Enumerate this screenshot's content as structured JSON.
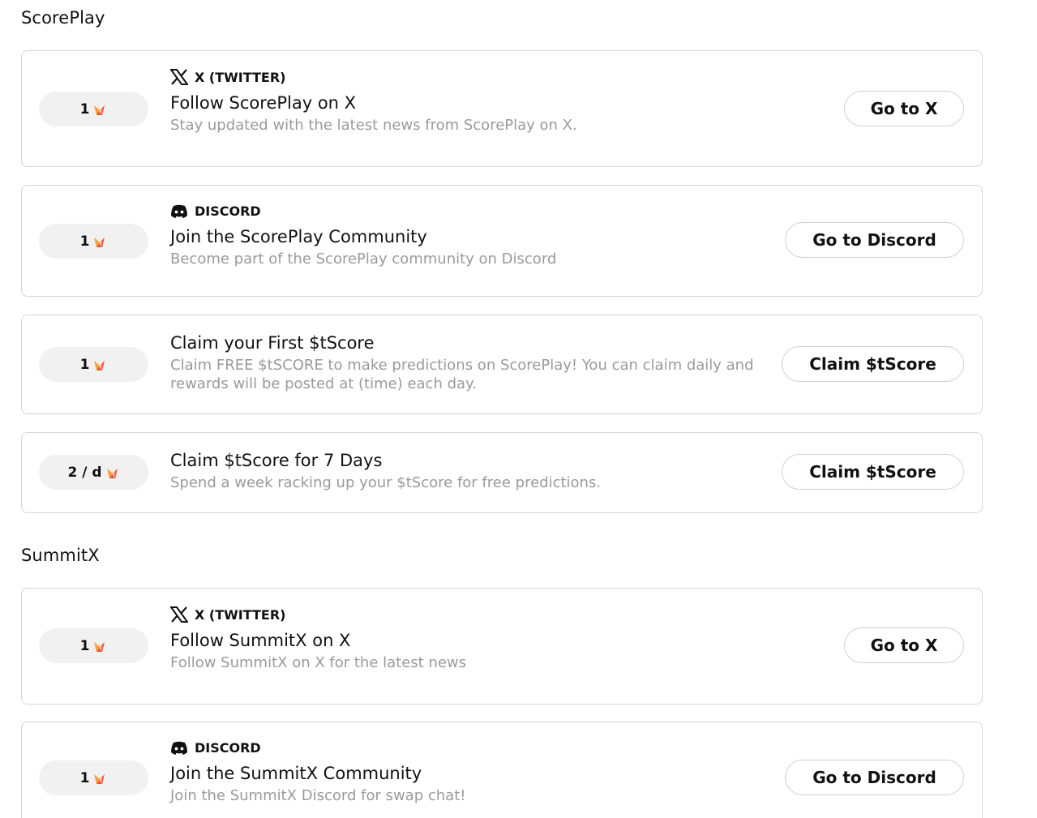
{
  "sections": [
    {
      "title": "ScorePlay",
      "tasks": [
        {
          "points": "1",
          "platform": "X (TWITTER)",
          "platform_icon": "x-logo-icon",
          "title": "Follow ScorePlay on X",
          "description": "Stay updated with the latest news from ScorePlay on X.",
          "button": "Go to X"
        },
        {
          "points": "1",
          "platform": "DISCORD",
          "platform_icon": "discord-logo-icon",
          "title": "Join the ScorePlay Community",
          "description": "Become part of the ScorePlay community on Discord",
          "button": "Go to Discord"
        },
        {
          "points": "1",
          "title": "Claim your First $tScore",
          "description": "Claim FREE $tSCORE to make predictions on ScorePlay! You can claim daily and rewards will be posted at (time) each day.",
          "button": "Claim $tScore"
        },
        {
          "points": "2 / d",
          "title": "Claim $tScore for 7 Days",
          "description": "Spend a week racking up your $tScore for free predictions.",
          "button": "Claim $tScore"
        }
      ]
    },
    {
      "title": "SummitX",
      "tasks": [
        {
          "points": "1",
          "platform": "X (TWITTER)",
          "platform_icon": "x-logo-icon",
          "title": "Follow SummitX on X",
          "description": "Follow SummitX on X for the latest news",
          "button": "Go to X"
        },
        {
          "points": "1",
          "platform": "DISCORD",
          "platform_icon": "discord-logo-icon",
          "title": "Join the SummitX Community",
          "description": "Join the SummitX Discord for swap chat!",
          "button": "Go to Discord"
        }
      ]
    }
  ],
  "points_icon": "flame-icon",
  "colors": {
    "flame_primary": "#f2542d",
    "flame_secondary": "#f7a13a",
    "points_bg": "#f1f1f2",
    "description_text": "#9a9a9a",
    "card_border": "#d6d6d6"
  }
}
